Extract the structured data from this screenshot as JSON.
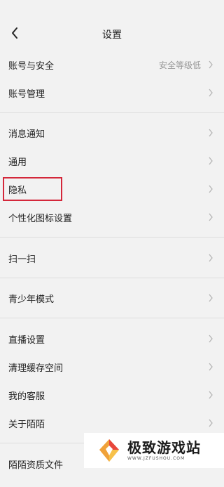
{
  "header": {
    "title": "设置"
  },
  "rows": [
    {
      "label": "账号与安全",
      "value": "安全等级低"
    },
    {
      "label": "账号管理",
      "value": ""
    },
    {
      "label": "消息通知",
      "value": ""
    },
    {
      "label": "通用",
      "value": ""
    },
    {
      "label": "隐私",
      "value": ""
    },
    {
      "label": "个性化图标设置",
      "value": ""
    },
    {
      "label": "扫一扫",
      "value": ""
    },
    {
      "label": "青少年模式",
      "value": ""
    },
    {
      "label": "直播设置",
      "value": ""
    },
    {
      "label": "清理缓存空间",
      "value": ""
    },
    {
      "label": "我的客服",
      "value": ""
    },
    {
      "label": "关于陌陌",
      "value": ""
    },
    {
      "label": "陌陌资质文件",
      "value": ""
    }
  ],
  "watermark": {
    "text": "极致游戏站",
    "sub": "WWW.JZFUSHOU.COM"
  },
  "colors": {
    "highlight": "#d4273a",
    "chevron": "#b5b5b5",
    "secondary_text": "#999999"
  }
}
